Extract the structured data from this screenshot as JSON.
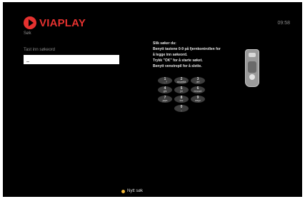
{
  "header": {
    "brand": "VIAPLAY",
    "clock": "09:58"
  },
  "search": {
    "section_title": "Søk",
    "input_label": "Tast inn søkeord",
    "input_value": "_"
  },
  "instructions": {
    "heading": "Slik søker du:",
    "lines": [
      "Benytt tastene 0-9 på fjernkontrollen for",
      "å legge inn søkeord.",
      "Trykk \"OK\" for å starte søket.",
      "Benytt venstrepil for å slette."
    ]
  },
  "keypad": {
    "keys": [
      {
        "digit": "1",
        "letters": ". , ?"
      },
      {
        "digit": "2",
        "letters": "abcæåä"
      },
      {
        "digit": "3",
        "letters": "def"
      },
      {
        "digit": "4",
        "letters": "ghi"
      },
      {
        "digit": "5",
        "letters": "jkl"
      },
      {
        "digit": "6",
        "letters": "mnoøö"
      },
      {
        "digit": "7",
        "letters": "pqrs"
      },
      {
        "digit": "8",
        "letters": "tuv"
      },
      {
        "digit": "9",
        "letters": "wxyz"
      },
      {
        "digit": "0",
        "letters": "_"
      }
    ]
  },
  "footer": {
    "new_search_label": "Nytt søk",
    "button_color": "#f2b83a"
  },
  "colors": {
    "brand": "#e5312f",
    "background": "#000000",
    "muted_text": "#8a8a8a"
  },
  "icons": {
    "remote": "remote-control-icon",
    "logo": "viaplay-play-icon"
  }
}
